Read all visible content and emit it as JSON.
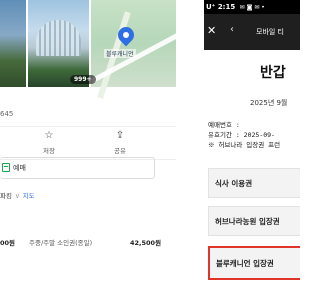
{
  "left": {
    "photo_count_badge": "999+",
    "map_pin_label": "블루캐니언",
    "phone_fragment": "645",
    "actions": {
      "save_label": "저장",
      "share_label": "공유"
    },
    "booking_label": "예매",
    "links": {
      "parking": "파킹",
      "separator": "∨",
      "map": "지도"
    },
    "price_row": {
      "price1": "00원",
      "desc": "주중/주말 소인권(종일)",
      "price2": "42,500원"
    }
  },
  "right": {
    "status_time": "U⁺ 2:15",
    "status_icons": "✉ ◙ ✉ •",
    "appbar": {
      "close": "✕",
      "back": "‹",
      "title": "모바일 티"
    },
    "welcome": "반갑",
    "date": "2025년 9월",
    "info": [
      "예매번호 :",
      "유효기간  : 2025-09-",
      "※ 허브나라 입장권 프런"
    ],
    "tickets": [
      "식사 이용권",
      "허브나라농원 입장권",
      "블루캐니언 입장권"
    ]
  },
  "colors": {
    "accent_blue": "#2f6fe4",
    "booking_green": "#1aa851",
    "highlight_red": "#e0342a",
    "appbar_dark": "#1f1f1f"
  },
  "icons": {
    "save": "star-outline-icon",
    "share": "share-icon",
    "booking": "calendar-icon",
    "close": "close-icon",
    "back": "chevron-left-icon"
  }
}
